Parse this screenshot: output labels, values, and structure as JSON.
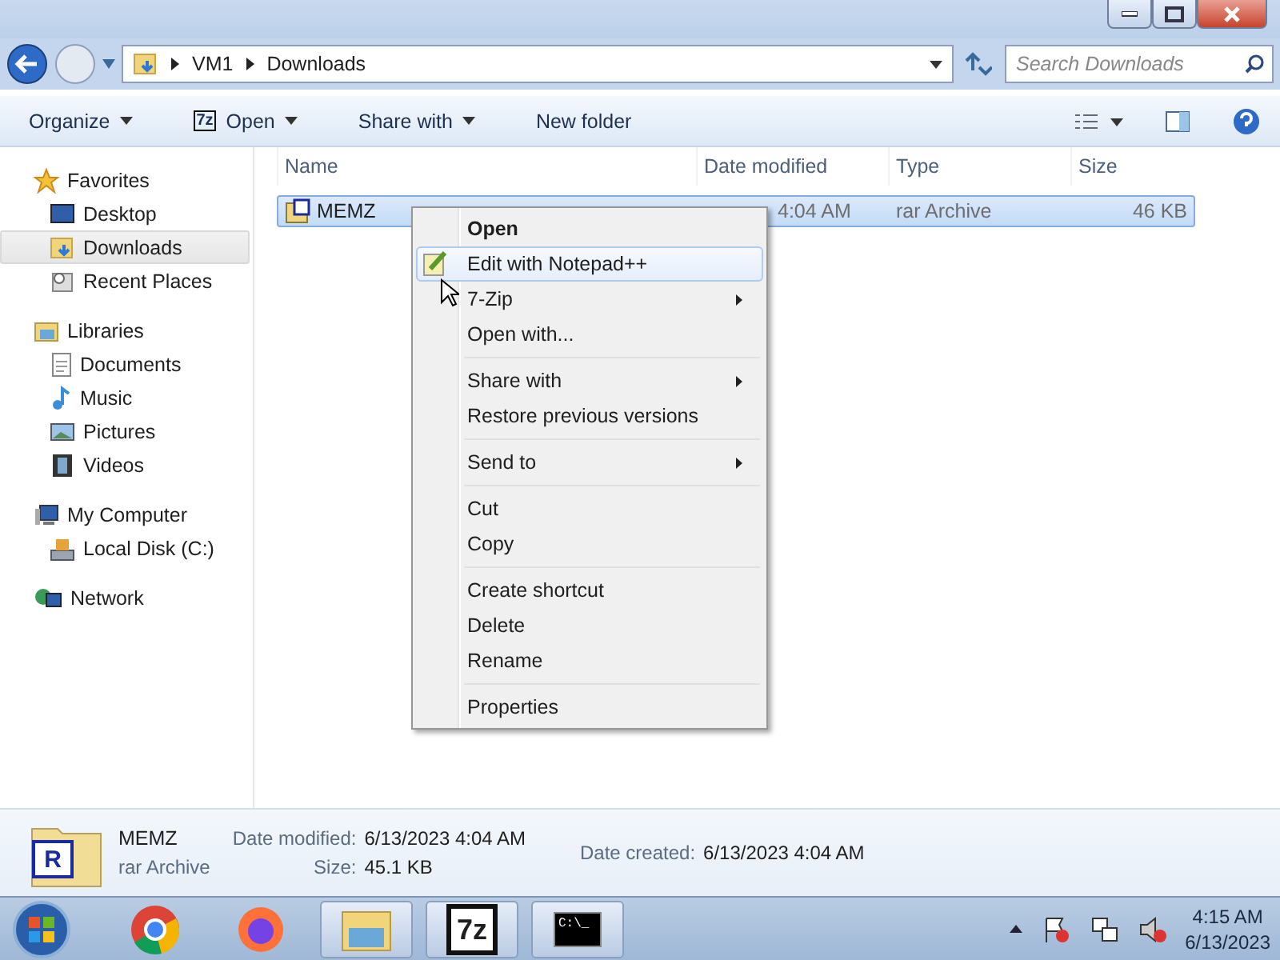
{
  "address": {
    "path": [
      "VM1",
      "Downloads"
    ]
  },
  "search": {
    "placeholder": "Search Downloads"
  },
  "toolbar": [
    {
      "label": "Organize",
      "dropdown": true
    },
    {
      "label": "Open",
      "dropdown": true,
      "icon_text": "7z"
    },
    {
      "label": "Share with",
      "dropdown": true
    },
    {
      "label": "New folder",
      "dropdown": false
    }
  ],
  "sidebar": [
    {
      "label": "Favorites",
      "kind": "star",
      "items": [
        {
          "label": "Desktop",
          "kind": "desktop",
          "selected": false
        },
        {
          "label": "Downloads",
          "kind": "downloads",
          "selected": true
        },
        {
          "label": "Recent Places",
          "kind": "recent",
          "selected": false
        }
      ]
    },
    {
      "label": "Libraries",
      "kind": "library",
      "items": [
        {
          "label": "Documents",
          "kind": "document",
          "selected": false
        },
        {
          "label": "Music",
          "kind": "music",
          "selected": false
        },
        {
          "label": "Pictures",
          "kind": "pictures",
          "selected": false
        },
        {
          "label": "Videos",
          "kind": "videos",
          "selected": false
        }
      ]
    },
    {
      "label": "My Computer",
      "kind": "computer",
      "items": [
        {
          "label": "Local Disk (C:)",
          "kind": "disk",
          "selected": false
        }
      ]
    },
    {
      "label": "Network",
      "kind": "network"
    }
  ],
  "columns": [
    "Name",
    "Date modified",
    "Type",
    "Size"
  ],
  "files": [
    {
      "name": "MEMZ",
      "date_modified": "4:04 AM",
      "type": "rar Archive",
      "size": "46 KB",
      "selected": true
    }
  ],
  "context_menu": [
    [
      {
        "label": "Open",
        "bold": true,
        "submenu": false,
        "highlighted": false
      },
      {
        "label": "Edit with Notepad++",
        "bold": false,
        "submenu": false,
        "highlighted": true,
        "kind": "notepad"
      },
      {
        "label": "7-Zip",
        "bold": false,
        "submenu": true,
        "highlighted": false
      },
      {
        "label": "Open with...",
        "bold": false,
        "submenu": false,
        "highlighted": false
      }
    ],
    [
      {
        "label": "Share with",
        "bold": false,
        "submenu": true,
        "highlighted": false
      },
      {
        "label": "Restore previous versions",
        "bold": false,
        "submenu": false,
        "highlighted": false
      }
    ],
    [
      {
        "label": "Send to",
        "bold": false,
        "submenu": true,
        "highlighted": false
      }
    ],
    [
      {
        "label": "Cut",
        "bold": false,
        "submenu": false,
        "highlighted": false
      },
      {
        "label": "Copy",
        "bold": false,
        "submenu": false,
        "highlighted": false
      }
    ],
    [
      {
        "label": "Create shortcut",
        "bold": false,
        "submenu": false,
        "highlighted": false
      },
      {
        "label": "Delete",
        "bold": false,
        "submenu": false,
        "highlighted": false
      },
      {
        "label": "Rename",
        "bold": false,
        "submenu": false,
        "highlighted": false
      }
    ],
    [
      {
        "label": "Properties",
        "bold": false,
        "submenu": false,
        "highlighted": false
      }
    ]
  ],
  "details": {
    "name": "MEMZ",
    "type": "rar Archive",
    "icon_text": "R",
    "columns": [
      [
        {
          "label": "Date modified:",
          "value": "6/13/2023 4:04 AM"
        },
        {
          "label": "Size:",
          "value": "45.1 KB"
        }
      ],
      [
        {
          "label": "Date created:",
          "value": "6/13/2023 4:04 AM"
        }
      ]
    ]
  },
  "taskbar": {
    "apps": [
      {
        "kind": "chrome",
        "running": false
      },
      {
        "kind": "firefox",
        "running": false
      },
      {
        "kind": "explorer",
        "running": true
      },
      {
        "kind": "sevenzip",
        "running": true,
        "icon_text": "7z"
      },
      {
        "kind": "cmd",
        "running": true,
        "icon_text": "C:\\_"
      }
    ],
    "clock": {
      "time": "4:15 AM",
      "date": "6/13/2023"
    }
  }
}
